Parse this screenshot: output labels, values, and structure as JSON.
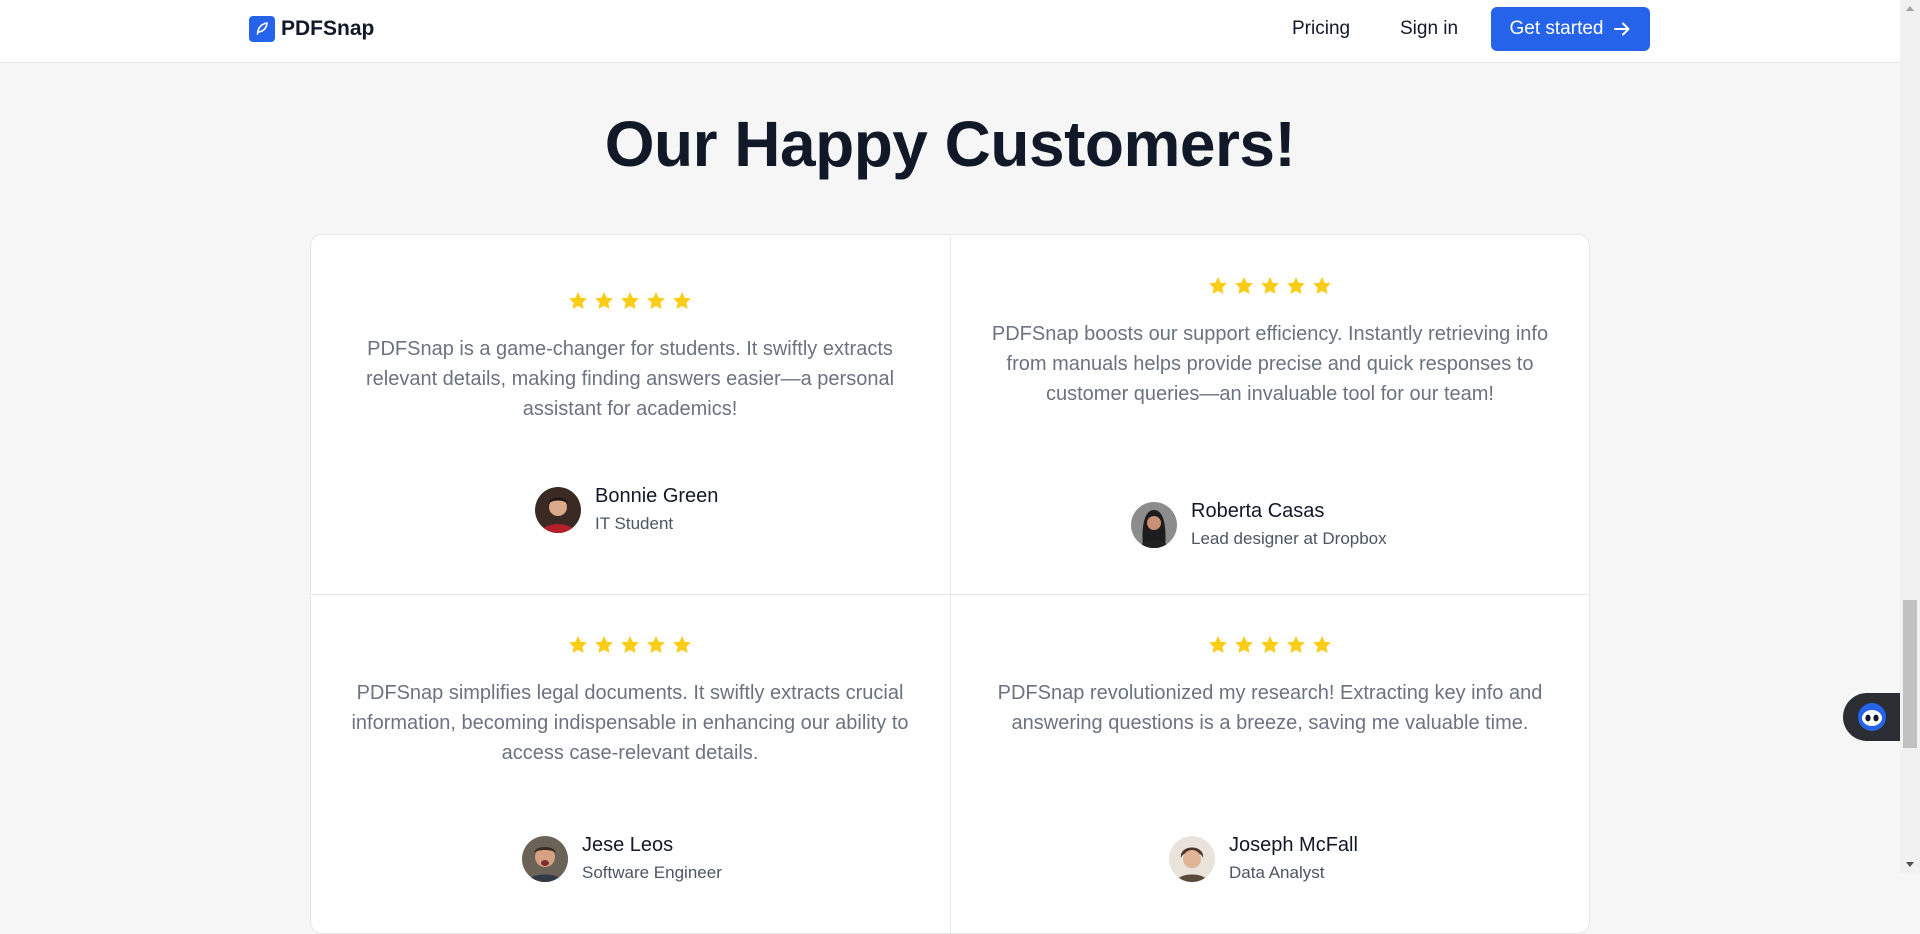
{
  "header": {
    "brand": "PDFSnap",
    "nav": {
      "pricing": "Pricing",
      "signin": "Sign in"
    },
    "cta": "Get started"
  },
  "section": {
    "title": "Our Happy Customers!"
  },
  "testimonials": [
    {
      "rating": 5,
      "quote": "PDFSnap is a game-changer for students. It swiftly extracts relevant details, making finding answers easier—a personal assistant for academics!",
      "name": "Bonnie Green",
      "role": "IT Student"
    },
    {
      "rating": 5,
      "quote": "PDFSnap boosts our support efficiency. Instantly retrieving info from manuals helps provide precise and quick responses to customer queries—an invaluable tool for our team!",
      "name": "Roberta Casas",
      "role": "Lead designer at Dropbox"
    },
    {
      "rating": 5,
      "quote": "PDFSnap simplifies legal documents. It swiftly extracts crucial information, becoming indispensable in enhancing our ability to access case-relevant details.",
      "name": "Jese Leos",
      "role": "Software Engineer"
    },
    {
      "rating": 5,
      "quote": "PDFSnap revolutionized my research! Extracting key info and answering questions is a breeze, saving me valuable time.",
      "name": "Joseph McFall",
      "role": "Data Analyst"
    }
  ],
  "colors": {
    "accent": "#2563eb",
    "star": "#facc15",
    "chat_widget": "#2a2e33"
  },
  "icons": {
    "logo": "feather-icon",
    "cta": "arrow-right-icon",
    "star": "star-icon",
    "chat": "chat-bot-icon"
  }
}
